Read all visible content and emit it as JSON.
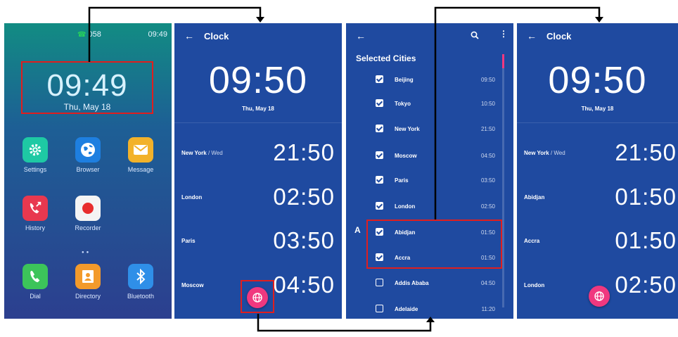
{
  "home": {
    "signal": "058",
    "status_time": "09:49",
    "time": "09:49",
    "date": "Thu, May 18",
    "apps": [
      {
        "label": "Settings",
        "icon": "gear-icon",
        "color": "#1ec9a4"
      },
      {
        "label": "Browser",
        "icon": "globe-icon",
        "color": "#1e7fe0"
      },
      {
        "label": "Message",
        "icon": "envelope-icon",
        "color": "#f2b22a"
      },
      {
        "label": "History",
        "icon": "missed-call-icon",
        "color": "#e8384f"
      },
      {
        "label": "Recorder",
        "icon": "record-icon",
        "color": "#f4f4f4"
      },
      {
        "label": "Dial",
        "icon": "phone-icon",
        "color": "#3cc45a"
      },
      {
        "label": "Directory",
        "icon": "contact-icon",
        "color": "#f39a2b"
      },
      {
        "label": "Bluetooth",
        "icon": "bluetooth-icon",
        "color": "#2f8fe8"
      }
    ]
  },
  "clock1": {
    "title": "Clock",
    "time": "09:50",
    "date": "Thu, May 18",
    "cities": [
      {
        "name": "New York",
        "sub": "/ Wed",
        "time": "21:50"
      },
      {
        "name": "London",
        "sub": "",
        "time": "02:50"
      },
      {
        "name": "Paris",
        "sub": "",
        "time": "03:50"
      },
      {
        "name": "Moscow",
        "sub": "",
        "time": "04:50"
      }
    ]
  },
  "picker": {
    "heading": "Selected Cities",
    "section_letter": "A",
    "cities": [
      {
        "name": "Beijing",
        "time": "09:50",
        "checked": true
      },
      {
        "name": "Tokyo",
        "time": "10:50",
        "checked": true
      },
      {
        "name": "New York",
        "time": "21:50",
        "checked": true
      },
      {
        "name": "Moscow",
        "time": "04:50",
        "checked": true
      },
      {
        "name": "Paris",
        "time": "03:50",
        "checked": true
      },
      {
        "name": "London",
        "time": "02:50",
        "checked": true
      },
      {
        "name": "Abidjan",
        "time": "01:50",
        "checked": true
      },
      {
        "name": "Accra",
        "time": "01:50",
        "checked": true
      },
      {
        "name": "Addis Ababa",
        "time": "04:50",
        "checked": false
      },
      {
        "name": "Adelaide",
        "time": "11:20",
        "checked": false
      }
    ]
  },
  "clock2": {
    "title": "Clock",
    "time": "09:50",
    "date": "Thu, May 18",
    "cities": [
      {
        "name": "New York",
        "sub": "/ Wed",
        "time": "21:50"
      },
      {
        "name": "Abidjan",
        "sub": "",
        "time": "01:50"
      },
      {
        "name": "Accra",
        "sub": "",
        "time": "01:50"
      },
      {
        "name": "London",
        "sub": "",
        "time": "02:50"
      }
    ]
  },
  "colors": {
    "highlight": "#e01e1e",
    "fab": "#f0387f",
    "screen": "#1f4aa0"
  }
}
